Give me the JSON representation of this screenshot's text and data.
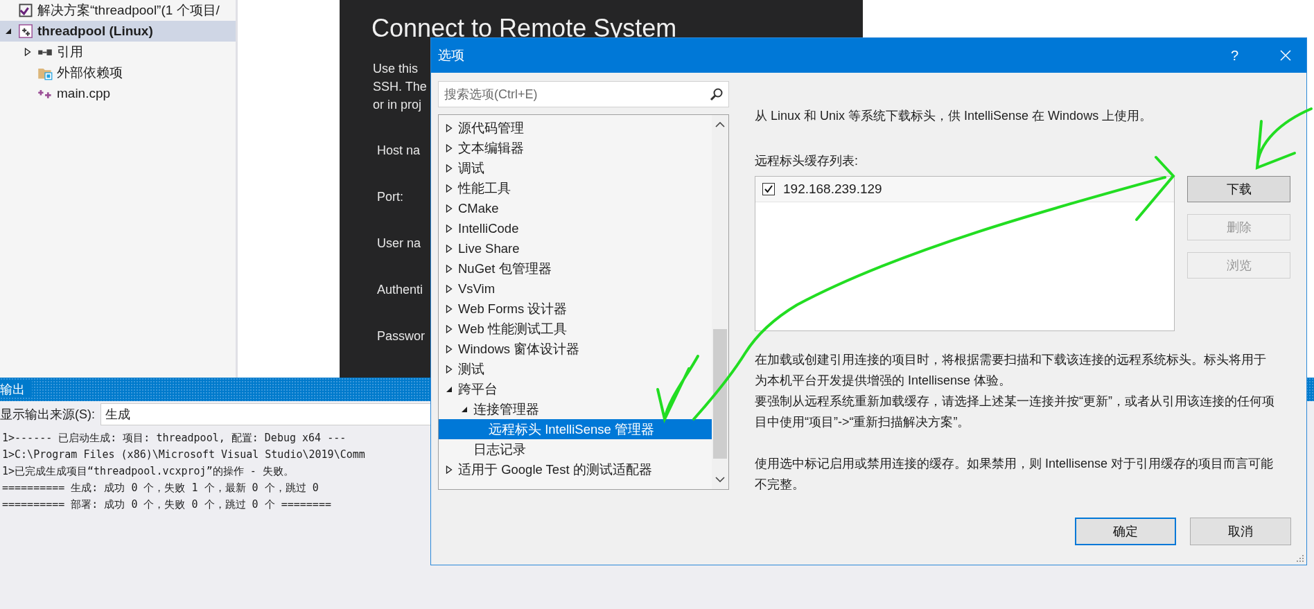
{
  "solution_explorer": {
    "items": [
      {
        "kind": "solution",
        "label": "解决方案“threadpool”(1 个项目/",
        "selected": false
      },
      {
        "kind": "project",
        "label": "threadpool (Linux)",
        "expanded": true,
        "selected": true,
        "children": [
          {
            "kind": "references",
            "label": "引用",
            "expanded": false,
            "selected": false
          },
          {
            "kind": "dependencies",
            "label": "外部依赖项",
            "selected": false
          },
          {
            "kind": "source",
            "label": "main.cpp",
            "selected": false
          }
        ]
      }
    ]
  },
  "remote_dialog": {
    "title": "Connect to Remote System",
    "description_lines": [
      "Use this",
      "SSH. The",
      "or in proj"
    ],
    "fields": [
      "Host na",
      "Port:",
      "User na",
      "Authenti",
      "Passwor"
    ]
  },
  "output": {
    "title": "输出",
    "source_label": "显示输出来源(S):",
    "source_value": "生成",
    "lines": [
      "1>------ 已启动生成: 项目: threadpool, 配置: Debug x64 ---",
      "1>C:\\Program Files (x86)\\Microsoft Visual Studio\\2019\\Comm",
      "1>已完成生成项目“threadpool.vcxproj”的操作 - 失败。",
      "========== 生成: 成功 0 个，失败 1 个，最新 0 个，跳过 0",
      "========== 部署: 成功 0 个，失败 0 个，跳过 0 个 ========"
    ]
  },
  "options": {
    "title": "选项",
    "help": "?",
    "search": {
      "placeholder": "搜索选项(Ctrl+E)"
    },
    "tree": [
      {
        "kind": "folder",
        "label": "源代码管理",
        "expanded": false,
        "selected": false
      },
      {
        "kind": "folder",
        "label": "文本编辑器",
        "expanded": false,
        "selected": false
      },
      {
        "kind": "folder",
        "label": "调试",
        "expanded": false,
        "selected": false
      },
      {
        "kind": "folder",
        "label": "性能工具",
        "expanded": false,
        "selected": false
      },
      {
        "kind": "folder",
        "label": "CMake",
        "expanded": false,
        "selected": false
      },
      {
        "kind": "folder",
        "label": "IntelliCode",
        "expanded": false,
        "selected": false
      },
      {
        "kind": "folder",
        "label": "Live Share",
        "expanded": false,
        "selected": false
      },
      {
        "kind": "folder",
        "label": "NuGet 包管理器",
        "expanded": false,
        "selected": false
      },
      {
        "kind": "folder",
        "label": "VsVim",
        "expanded": false,
        "selected": false
      },
      {
        "kind": "folder",
        "label": "Web Forms 设计器",
        "expanded": false,
        "selected": false
      },
      {
        "kind": "folder",
        "label": "Web 性能测试工具",
        "expanded": false,
        "selected": false
      },
      {
        "kind": "folder",
        "label": "Windows 窗体设计器",
        "expanded": false,
        "selected": false
      },
      {
        "kind": "folder",
        "label": "测试",
        "expanded": false,
        "selected": false
      },
      {
        "kind": "folder",
        "label": "跨平台",
        "expanded": true,
        "selected": false,
        "children": [
          {
            "kind": "folder",
            "label": "连接管理器",
            "expanded": true,
            "selected": false,
            "children": [
              {
                "kind": "leaf",
                "label": "远程标头 IntelliSense 管理器",
                "selected": true
              }
            ]
          },
          {
            "kind": "leaf",
            "label": "日志记录",
            "selected": false
          }
        ]
      },
      {
        "kind": "folder",
        "label": "适用于 Google Test 的测试适配器",
        "expanded": false,
        "selected": false
      }
    ],
    "intro": "从 Linux 和 Unix 等系统下载标头，供 IntelliSense 在 Windows 上使用。",
    "list_label": "远程标头缓存列表:",
    "hosts": [
      {
        "label": "192.168.239.129",
        "checked": true
      }
    ],
    "side_buttons": [
      {
        "label": "下载",
        "disabled": false
      },
      {
        "label": "删除",
        "disabled": true
      },
      {
        "label": "浏览",
        "disabled": true
      }
    ],
    "paragraphs": [
      "在加载或创建引用连接的项目时，将根据需要扫描和下载该连接的远程系统标头。标头将用于为本机平台开发提供增强的 Intellisense 体验。",
      "要强制从远程系统重新加载缓存，请选择上述某一连接并按“更新”，或者从引用该连接的任何项目中使用“项目”->“重新扫描解决方案”。",
      "使用选中标记启用或禁用连接的缓存。如果禁用，则 Intellisense 对于引用缓存的项目而言可能不完整。"
    ],
    "footer_buttons": [
      {
        "label": "确定",
        "default": true
      },
      {
        "label": "取消",
        "default": false
      }
    ]
  }
}
